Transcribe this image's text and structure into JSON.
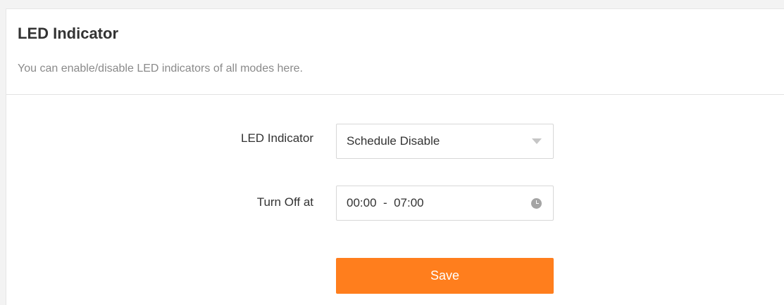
{
  "header": {
    "title": "LED Indicator",
    "description": "You can enable/disable LED indicators of all modes here."
  },
  "form": {
    "led_label": "LED Indicator",
    "led_value": "Schedule Disable",
    "turnoff_label": "Turn Off at",
    "turnoff_value": "00:00  -  07:00",
    "save_label": "Save"
  },
  "colors": {
    "accent": "#ff7e1d",
    "icon": "#a4a4a4"
  },
  "icons": {
    "dropdown": "caret-down-icon",
    "time": "clock-icon"
  }
}
